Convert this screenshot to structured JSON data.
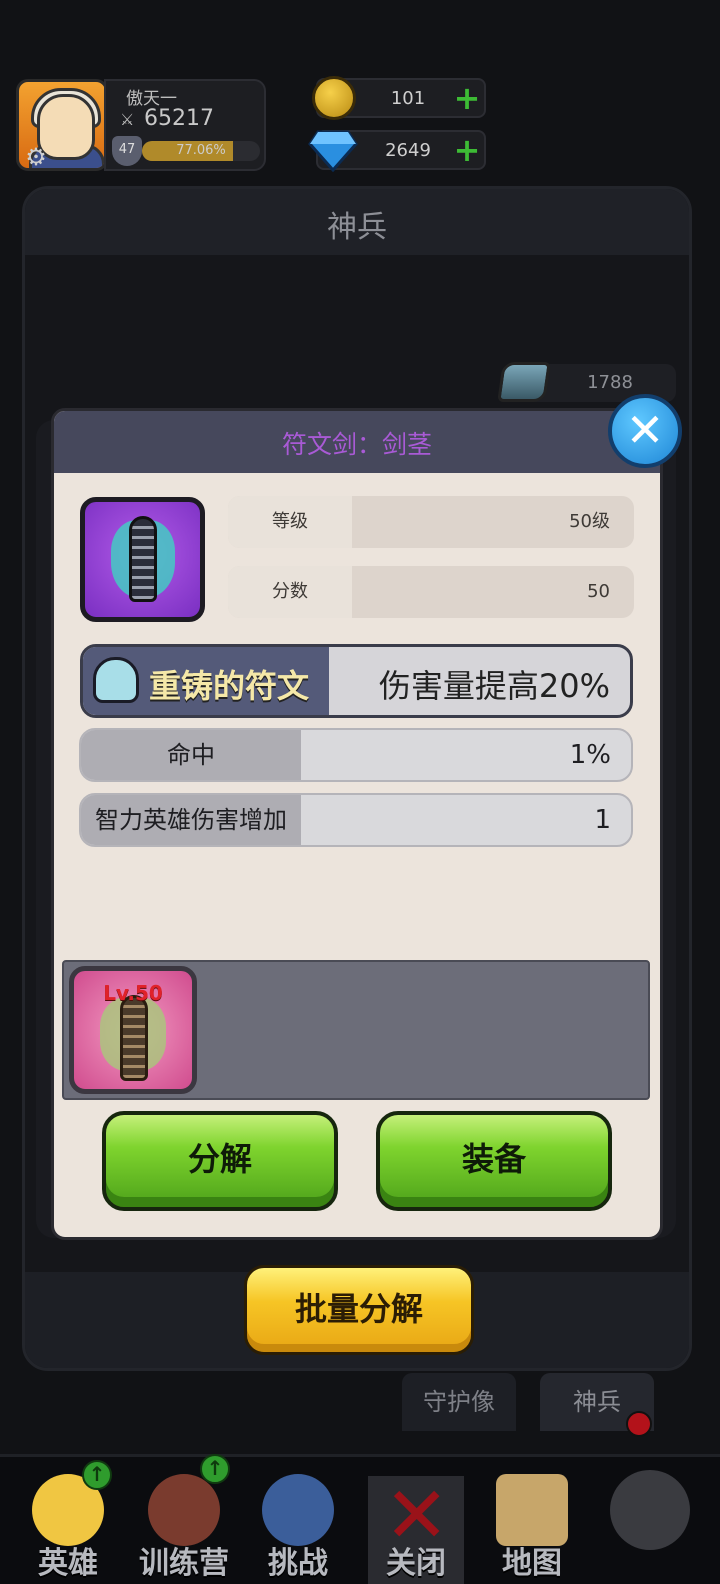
{
  "player": {
    "name": "傲天一",
    "power": "65217",
    "level": "47",
    "exp_text": "77.06%",
    "exp_fraction": 0.7706
  },
  "resources": {
    "gold": "101",
    "gems": "2649",
    "ore": "1788"
  },
  "panel": {
    "title": "神兵"
  },
  "tabs": [
    {
      "label": "守护像"
    },
    {
      "label": "神兵"
    }
  ],
  "batch_button": {
    "label": "批量分解"
  },
  "nav": [
    {
      "label": "英雄",
      "badge": "up-arrow-icon"
    },
    {
      "label": "训练营",
      "badge": "up-arrow-icon"
    },
    {
      "label": "挑战"
    },
    {
      "label": "关闭"
    },
    {
      "label": "地图"
    },
    {
      "label": ""
    }
  ],
  "modal": {
    "title": "符文剑：剑茎",
    "stats": [
      {
        "key": "等级",
        "value": "50级"
      },
      {
        "key": "分数",
        "value": "50"
      }
    ],
    "rune": {
      "name": "重铸的符文",
      "effect": "伤害量提高20%"
    },
    "attributes": [
      {
        "key": "命中",
        "value": "1%"
      },
      {
        "key": "智力英雄伤害增加",
        "value": "1"
      }
    ],
    "inventory": [
      {
        "level_label": "Lv.50"
      }
    ],
    "buttons": {
      "decompose": "分解",
      "equip": "装备"
    }
  },
  "colors": {
    "title_purple": "#a95ad6",
    "green_button": "#7fd42e",
    "yellow_button": "#f6c525",
    "close_blue": "#1e86d6"
  }
}
